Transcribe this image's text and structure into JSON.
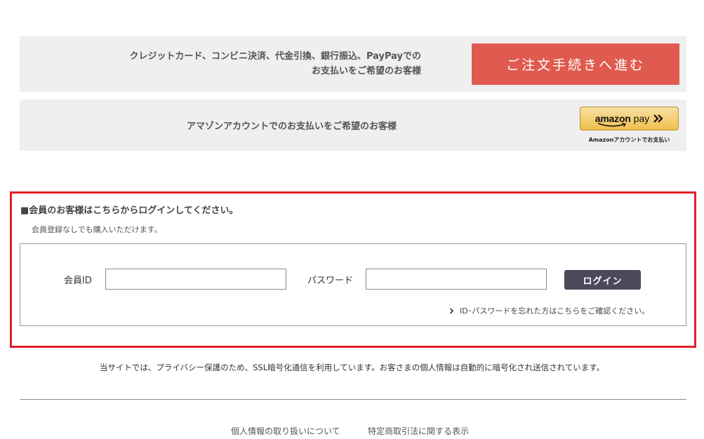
{
  "payment": {
    "card_option": {
      "line1": "クレジットカード、コンビニ決済、代金引換、銀行振込、PayPayでの",
      "line2": "お支払いをご希望のお客様",
      "button_label": "ご注文手続きへ進む",
      "button_color": "#e05a4f"
    },
    "amazon_option": {
      "text": "アマゾンアカウントでのお支払いをご希望のお客様",
      "button_word": "amazon",
      "button_pay": "pay",
      "caption": "Amazonアカウントでお支払い",
      "button_color": "#f0c14b"
    }
  },
  "login": {
    "heading": "■会員のお客様はこちらからログインしてください。",
    "note": "会員登録なしでも購入いただけます。",
    "id_label": "会員ID",
    "id_value": "",
    "password_label": "パスワード",
    "password_value": "",
    "button_label": "ログイン",
    "forgot_link": "ID･パスワードを忘れた方はこちらをご確認ください。",
    "border_color": "#e0202a"
  },
  "ssl_note": "当サイトでは、プライバシー保護のため、SSL暗号化通信を利用しています。お客さまの個人情報は自動的に暗号化され送信されています。",
  "footer": {
    "links": [
      "個人情報の取り扱いについて",
      "特定商取引法に関する表示"
    ]
  }
}
